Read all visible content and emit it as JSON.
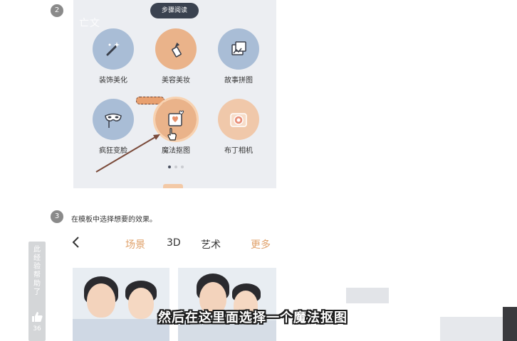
{
  "steps": [
    {
      "number": "2",
      "text": ""
    },
    {
      "number": "3",
      "text": "在模板中选择想要的效果。"
    }
  ],
  "screenshot1": {
    "watermark": "亡文",
    "pill_tab": "步骤阅读",
    "apps": [
      {
        "label": "装饰美化",
        "icon": "magic-wand-icon",
        "color": "#a9bdd6"
      },
      {
        "label": "美容美妆",
        "icon": "lipstick-icon",
        "color": "#eab38a"
      },
      {
        "label": "故事拼图",
        "icon": "photo-collage-icon",
        "color": "#a9bdd6"
      },
      {
        "label": "疯狂变脸",
        "icon": "mask-icon",
        "color": "#a9bdd6"
      },
      {
        "label": "魔法抠图",
        "icon": "heart-photo-icon",
        "color": "#eab38a"
      },
      {
        "label": "布丁相机",
        "icon": "camera-icon",
        "color": "#f0c8aa"
      }
    ],
    "page_dots": 3,
    "active_dot": 0
  },
  "screenshot2": {
    "back_icon": "chevron-left-icon",
    "tabs": [
      "场景",
      "3D",
      "艺术"
    ],
    "more": "更多"
  },
  "side_bar": {
    "text": "此经验帮助了",
    "count": "36"
  },
  "subtitle": "然后在这里面选择一个魔法抠图",
  "colors": {
    "accent_orange": "#e0a16a",
    "tile_blue": "#a9bdd6",
    "tile_orange": "#eab38a",
    "arrow": "#7a4a3a"
  }
}
